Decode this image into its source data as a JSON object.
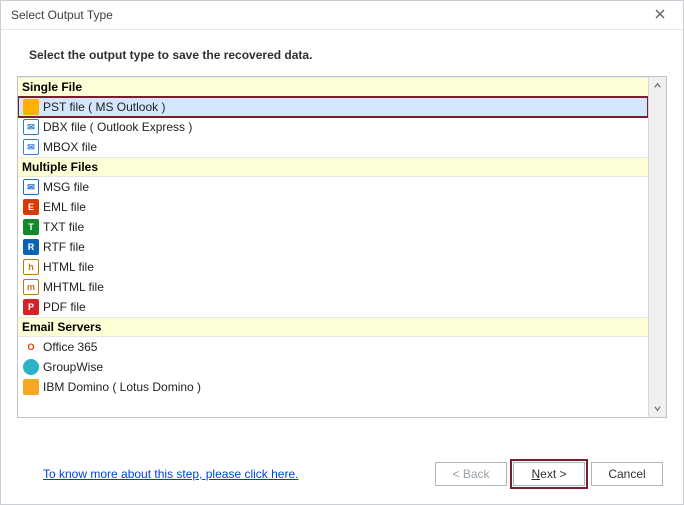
{
  "title": "Select Output Type",
  "subtitle": "Select the output type to save the recovered data.",
  "icons": {
    "pst": {
      "bg": "#ffb100",
      "fg": "#fff",
      "char": "",
      "border": ""
    },
    "dbx": {
      "bg": "#fff",
      "fg": "#2a7cc7",
      "char": "✉",
      "border": "1px solid #2a7cc7"
    },
    "mbox": {
      "bg": "#fff",
      "fg": "#3b7de0",
      "char": "✉",
      "border": "1px solid #3b7de0"
    },
    "msg": {
      "bg": "#fff",
      "fg": "#1e66d0",
      "char": "✉",
      "border": "1px solid #1e66d0"
    },
    "eml": {
      "bg": "#d83b01",
      "fg": "#fff",
      "char": "E",
      "border": ""
    },
    "txt": {
      "bg": "#128a2b",
      "fg": "#fff",
      "char": "T",
      "border": ""
    },
    "rtf": {
      "bg": "#0b63b6",
      "fg": "#fff",
      "char": "R",
      "border": ""
    },
    "html": {
      "bg": "#fff",
      "fg": "#c1780a",
      "char": "h",
      "border": "1px solid #c1780a"
    },
    "mhtml": {
      "bg": "#fff",
      "fg": "#c1780a",
      "char": "m",
      "border": "1px solid #c1780a"
    },
    "pdf": {
      "bg": "#d2232a",
      "fg": "#fff",
      "char": "P",
      "border": ""
    },
    "o365": {
      "bg": "#fff",
      "fg": "#d83b01",
      "char": "O",
      "border": ""
    },
    "gw": {
      "bg": "#2bb4c9",
      "fg": "#fff",
      "char": "",
      "border": ""
    },
    "dom": {
      "bg": "#f5a623",
      "fg": "#fff",
      "char": "",
      "border": ""
    }
  },
  "sections": [
    {
      "name": "single",
      "title": "Single File",
      "items": [
        {
          "id": "pst",
          "icon": "pst",
          "label": "PST file ( MS Outlook )",
          "selected": true
        },
        {
          "id": "dbx",
          "icon": "dbx",
          "label": "DBX file ( Outlook Express )"
        },
        {
          "id": "mbox",
          "icon": "mbox",
          "label": "MBOX file"
        }
      ]
    },
    {
      "name": "multi",
      "title": "Multiple Files",
      "items": [
        {
          "id": "msg",
          "icon": "msg",
          "label": "MSG file"
        },
        {
          "id": "eml",
          "icon": "eml",
          "label": "EML file"
        },
        {
          "id": "txt",
          "icon": "txt",
          "label": "TXT file"
        },
        {
          "id": "rtf",
          "icon": "rtf",
          "label": "RTF file"
        },
        {
          "id": "html",
          "icon": "html",
          "label": "HTML file"
        },
        {
          "id": "mhtml",
          "icon": "mhtml",
          "label": "MHTML file"
        },
        {
          "id": "pdf",
          "icon": "pdf",
          "label": "PDF file"
        }
      ]
    },
    {
      "name": "servers",
      "title": "Email Servers",
      "items": [
        {
          "id": "o365",
          "icon": "o365",
          "label": "Office 365"
        },
        {
          "id": "gw",
          "icon": "gw",
          "label": "GroupWise"
        },
        {
          "id": "domino",
          "icon": "dom",
          "label": "IBM Domino ( Lotus Domino )"
        }
      ]
    }
  ],
  "help_link": "To know more about this step, please click here.",
  "buttons": {
    "back": "< Back",
    "next_prefix": "N",
    "next_rest": "ext >",
    "cancel": "Cancel"
  }
}
